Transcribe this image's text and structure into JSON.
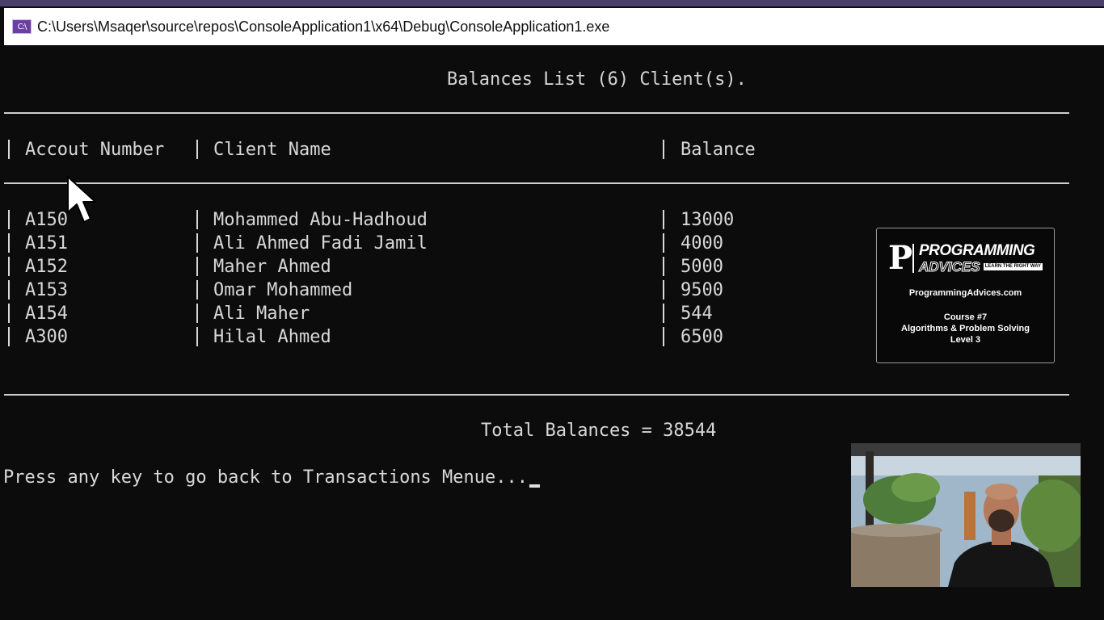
{
  "window": {
    "icon_label": "C:\\",
    "title": "C:\\Users\\Msaqer\\source\\repos\\ConsoleApplication1\\x64\\Debug\\ConsoleApplication1.exe"
  },
  "console": {
    "heading": "Balances List (6) Client(s).",
    "columns": {
      "account_number": "Accout Number",
      "client_name": "Client Name",
      "balance": "Balance"
    },
    "rows": [
      {
        "account": "A150",
        "name": "Mohammed Abu-Hadhoud",
        "balance": "13000"
      },
      {
        "account": "A151",
        "name": "Ali Ahmed Fadi Jamil",
        "balance": "4000"
      },
      {
        "account": "A152",
        "name": "Maher Ahmed",
        "balance": "5000"
      },
      {
        "account": "A153",
        "name": "Omar Mohammed",
        "balance": "9500"
      },
      {
        "account": "A154",
        "name": "Ali Maher",
        "balance": "544"
      },
      {
        "account": "A300",
        "name": "Hilal Ahmed",
        "balance": "6500"
      }
    ],
    "total": "Total Balances = 38544",
    "prompt": "Press any key to go back to Transactions Menue..."
  },
  "overlay": {
    "logo_line1": "PROGRAMMING",
    "logo_line2": "ADVICES",
    "logo_tagline": "LEARN THE RIGHT WAY",
    "site": "ProgrammingAdvices.com",
    "course": "Course #7",
    "course_title": "Algorithms & Problem Solving",
    "level": "Level 3"
  },
  "colors": {
    "console_bg": "#0c0c0c",
    "console_text": "#cccccc",
    "titlebar_bg": "#ffffff",
    "app_icon": "#6b3fa0"
  },
  "icons": {
    "app": "console-app-icon",
    "pointer": "mouse-pointer-icon"
  }
}
